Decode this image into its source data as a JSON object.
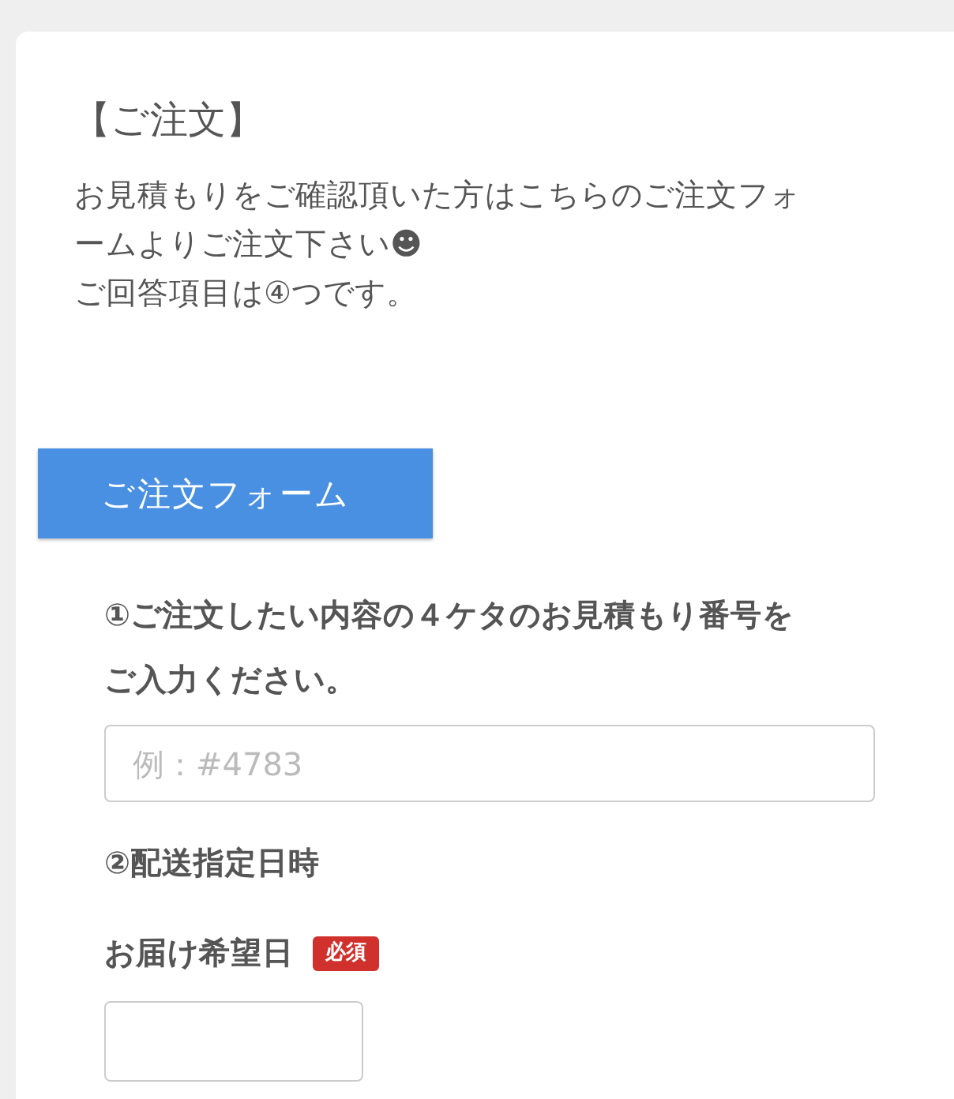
{
  "heading": "【ご注文】",
  "intro": [
    "お見積もりをご確認頂いた方はこちらのご注文フォームよりご注文下さい☻",
    "ご回答項目は④つです。"
  ],
  "form_button": "ご注文フォーム",
  "questions": [
    {
      "kind": "text",
      "label": "①ご注文したい内容の４ケタのお見積もり番号をご入力ください。",
      "placeholder": "例：#4783"
    },
    {
      "kind": "heading",
      "label": "②配送指定日時"
    },
    {
      "kind": "date",
      "label": "お届け希望日",
      "badge": "必須"
    }
  ]
}
